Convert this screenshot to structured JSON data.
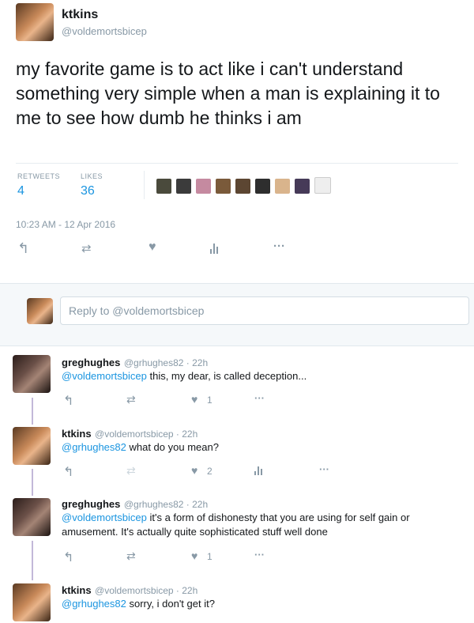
{
  "main_tweet": {
    "name": "ktkins",
    "handle": "@voldemortsbicep",
    "text": "my favorite game is to act like i can't understand something very simple when a man is explaining it to me to see how dumb he thinks i am",
    "retweets_label": "RETWEETS",
    "retweets": "4",
    "likes_label": "LIKES",
    "likes": "36",
    "timestamp": "10:23 AM - 12 Apr 2016"
  },
  "reply_box": {
    "placeholder": "Reply to @voldemortsbicep"
  },
  "replies": [
    {
      "name": "greghughes",
      "meta": "@grhughes82 · 22h",
      "mention": "@voldemortsbicep",
      "text": " this, my dear, is called deception...",
      "like_count": "1"
    },
    {
      "name": "ktkins",
      "meta": "@voldemortsbicep · 22h",
      "mention": "@grhughes82",
      "text": " what do you mean?",
      "like_count": "2"
    },
    {
      "name": "greghughes",
      "meta": "@grhughes82 · 22h",
      "mention": "@voldemortsbicep",
      "text": " it's a form of dishonesty that you are using for self gain or amusement. It's actually quite sophisticated stuff well done",
      "like_count": "1"
    },
    {
      "name": "ktkins",
      "meta": "@voldemortsbicep · 22h",
      "mention": "@grhughes82",
      "text": " sorry, i don't get it?"
    }
  ],
  "icons": {
    "reply": "reply-icon",
    "retweet": "retweet-icon",
    "like": "heart-icon",
    "analytics": "analytics-icon",
    "more": "more-icon"
  },
  "colors": {
    "link": "#1b95e0",
    "muted": "#8899a6",
    "thread": "#c2b8d8"
  }
}
